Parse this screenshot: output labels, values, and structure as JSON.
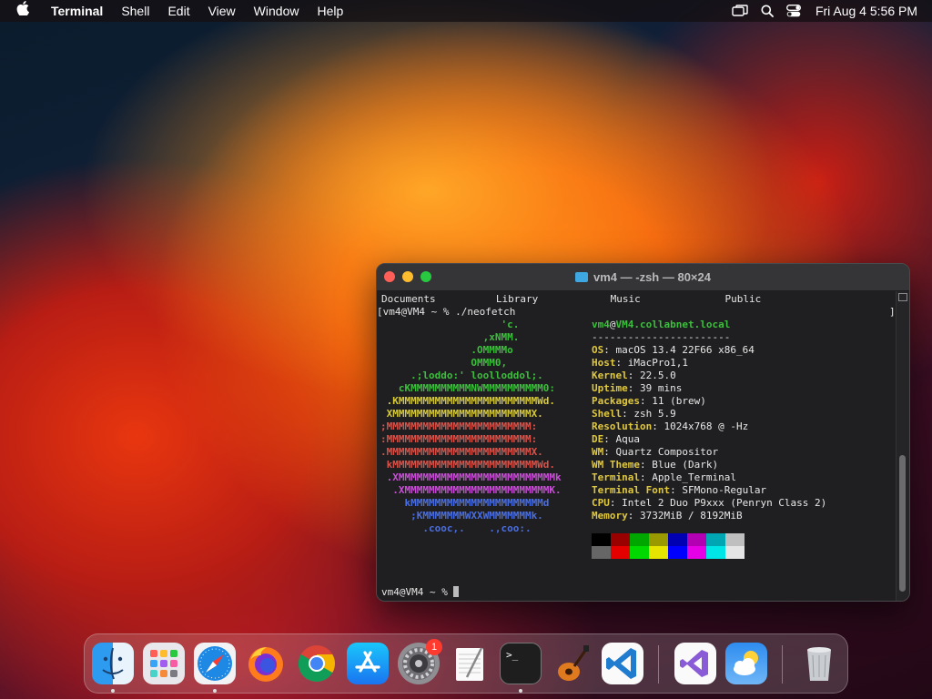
{
  "menubar": {
    "app_name": "Terminal",
    "menus": [
      "Shell",
      "Edit",
      "View",
      "Window",
      "Help"
    ],
    "clock": "Fri Aug 4  5:56 PM",
    "status_icons": [
      "screen-mirroring-icon",
      "search-icon",
      "control-center-icon"
    ]
  },
  "terminal": {
    "title": "vm4 — -zsh — 80×24",
    "ls_output": "Documents          Library            Music              Public",
    "prompt_command": "[vm4@VM4 ~ % ./neofetch",
    "end_bracket": "]",
    "final_prompt": "vm4@VM4 ~ % ",
    "ascii_logo": [
      {
        "text": "                    'c.",
        "color": "#3cbf3c"
      },
      {
        "text": "                 ,xNMM.",
        "color": "#3cbf3c"
      },
      {
        "text": "               .OMMMMo",
        "color": "#3cbf3c"
      },
      {
        "text": "               OMMM0,",
        "color": "#3cbf3c"
      },
      {
        "text": "     .;loddo:' loolloddol;.",
        "color": "#3cbf3c"
      },
      {
        "text": "   cKMMMMMMMMMMNWMMMMMMMMMM0:",
        "color": "#3cbf3c"
      },
      {
        "text": " .KMMMMMMMMMMMMMMMMMMMMMMMWd.",
        "color": "#d6c93a"
      },
      {
        "text": " XMMMMMMMMMMMMMMMMMMMMMMMX.",
        "color": "#d6c93a"
      },
      {
        "text": ";MMMMMMMMMMMMMMMMMMMMMMMM:",
        "color": "#d9534a"
      },
      {
        "text": ":MMMMMMMMMMMMMMMMMMMMMMMM:",
        "color": "#d9534a"
      },
      {
        "text": ".MMMMMMMMMMMMMMMMMMMMMMMMX.",
        "color": "#d9534a"
      },
      {
        "text": " kMMMMMMMMMMMMMMMMMMMMMMMMWd.",
        "color": "#d9534a"
      },
      {
        "text": " .XMMMMMMMMMMMMMMMMMMMMMMMMMMk",
        "color": "#c94fd6"
      },
      {
        "text": "  .XMMMMMMMMMMMMMMMMMMMMMMMMK.",
        "color": "#c94fd6"
      },
      {
        "text": "    kMMMMMMMMMMMMMMMMMMMMMMd",
        "color": "#4a6ee0"
      },
      {
        "text": "     ;KMMMMMMMWXXWMMMMMMMk.",
        "color": "#4a6ee0"
      },
      {
        "text": "       .cooc,.    .,coo:.",
        "color": "#4a6ee0"
      }
    ],
    "user_host_user": "vm4",
    "user_host_at": "@",
    "user_host_host": "VM4.collabnet.local",
    "separator": "-----------------------",
    "info": [
      {
        "key": "OS",
        "value": "macOS 13.4 22F66 x86_64"
      },
      {
        "key": "Host",
        "value": "iMacPro1,1"
      },
      {
        "key": "Kernel",
        "value": "22.5.0"
      },
      {
        "key": "Uptime",
        "value": "39 mins"
      },
      {
        "key": "Packages",
        "value": "11 (brew)"
      },
      {
        "key": "Shell",
        "value": "zsh 5.9"
      },
      {
        "key": "Resolution",
        "value": "1024x768 @ -Hz"
      },
      {
        "key": "DE",
        "value": "Aqua"
      },
      {
        "key": "WM",
        "value": "Quartz Compositor"
      },
      {
        "key": "WM Theme",
        "value": "Blue (Dark)"
      },
      {
        "key": "Terminal",
        "value": "Apple_Terminal"
      },
      {
        "key": "Terminal Font",
        "value": "SFMono-Regular"
      },
      {
        "key": "CPU",
        "value": "Intel 2 Duo P9xxx (Penryn Class 2)"
      },
      {
        "key": "Memory",
        "value": "3732MiB / 8192MiB"
      }
    ],
    "palette_top": [
      "#000000",
      "#990000",
      "#00a600",
      "#999900",
      "#0000b2",
      "#b200b2",
      "#00a6b2",
      "#bfbfbf"
    ],
    "palette_bottom": [
      "#666666",
      "#e50000",
      "#00d900",
      "#e5e500",
      "#0000ff",
      "#e500e5",
      "#00e5e5",
      "#e5e5e5"
    ]
  },
  "dock": {
    "apps": [
      {
        "name": "Finder",
        "icon": "finder-icon",
        "running": true
      },
      {
        "name": "Launchpad",
        "icon": "launchpad-icon",
        "running": false
      },
      {
        "name": "Safari",
        "icon": "safari-icon",
        "running": true
      },
      {
        "name": "Firefox",
        "icon": "firefox-icon",
        "running": false
      },
      {
        "name": "Google Chrome",
        "icon": "chrome-icon",
        "running": false
      },
      {
        "name": "App Store",
        "icon": "app-store-icon",
        "running": false
      },
      {
        "name": "System Settings",
        "icon": "system-settings-icon",
        "running": false,
        "badge": "1"
      },
      {
        "name": "TextEdit",
        "icon": "textedit-icon",
        "running": false
      },
      {
        "name": "Terminal",
        "icon": "terminal-icon",
        "running": true
      },
      {
        "name": "GarageBand",
        "icon": "garageband-icon",
        "running": false
      },
      {
        "name": "Visual Studio Code",
        "icon": "vscode-icon",
        "running": false
      },
      {
        "name": "Visual Studio",
        "icon": "visual-studio-icon",
        "running": false
      },
      {
        "name": "Weather",
        "icon": "weather-icon",
        "running": false
      },
      {
        "name": "Trash",
        "icon": "trash-icon",
        "running": false
      }
    ],
    "terminal_prompt_glyph": ">_"
  }
}
